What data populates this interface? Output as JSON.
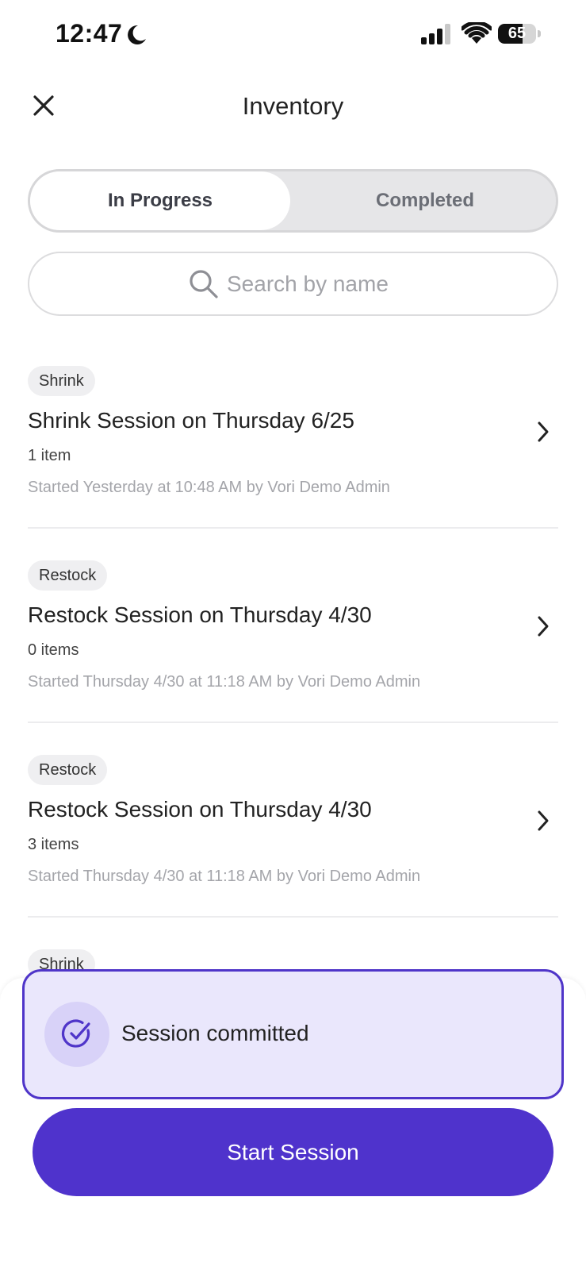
{
  "status_bar": {
    "time": "12:47",
    "battery_level": "65",
    "battery_fraction": 0.65
  },
  "header": {
    "title": "Inventory"
  },
  "tabs": [
    {
      "label": "In Progress",
      "active": true
    },
    {
      "label": "Completed",
      "active": false
    }
  ],
  "search": {
    "placeholder": "Search by name",
    "value": ""
  },
  "sessions": [
    {
      "tag": "Shrink",
      "title": "Shrink Session on Thursday 6/25",
      "count": "1 item",
      "meta": "Started Yesterday at 10:48 AM by Vori Demo Admin"
    },
    {
      "tag": "Restock",
      "title": "Restock Session on Thursday 4/30",
      "count": "0 items",
      "meta": "Started Thursday 4/30 at 11:18 AM by Vori Demo Admin"
    },
    {
      "tag": "Restock",
      "title": "Restock Session on Thursday 4/30",
      "count": "3 items",
      "meta": "Started Thursday 4/30 at 11:18 AM by Vori Demo Admin"
    },
    {
      "tag": "Shrink"
    }
  ],
  "toast": {
    "message": "Session committed"
  },
  "cta": {
    "label": "Start Session"
  },
  "colors": {
    "accent": "#4f33cc",
    "toast_bg": "#eae7fc",
    "toast_border": "#4f35c9"
  }
}
